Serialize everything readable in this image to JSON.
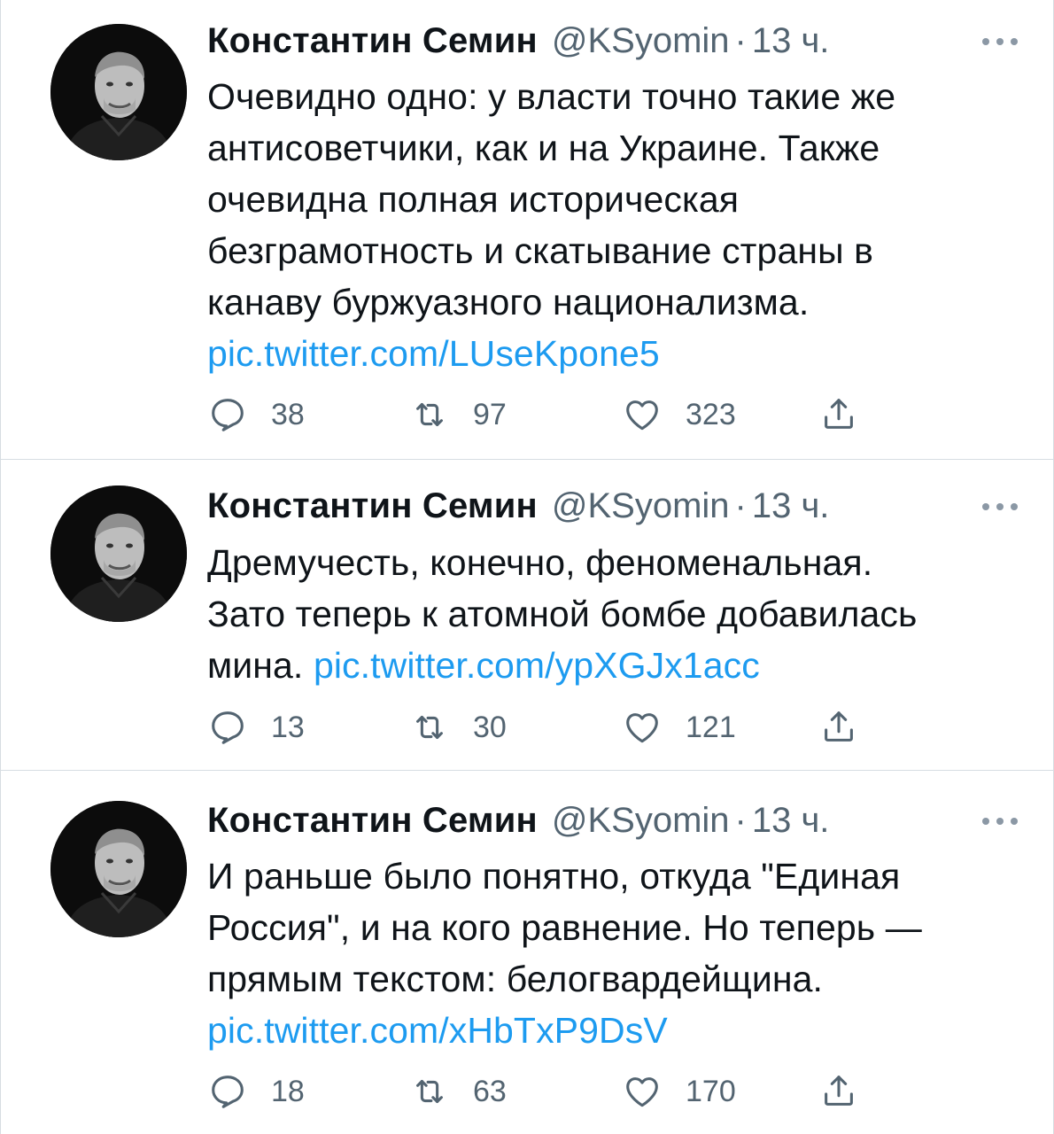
{
  "tweets": [
    {
      "author_name": "Константин Семин",
      "handle": "@KSyomin",
      "separator": "·",
      "time": "13 ч.",
      "text_lines": [
        "Очевидно одно: у власти точно такие же",
        "антисоветчики, как и на Украине. Также",
        "очевидна полная историческая",
        "безграмотность и скатывание страны в",
        "канаву буржуазного национализма."
      ],
      "link": "pic.twitter.com/LUseKpone5",
      "replies": "38",
      "retweets": "97",
      "likes": "323"
    },
    {
      "author_name": "Константин Семин",
      "handle": "@KSyomin",
      "separator": "·",
      "time": "13 ч.",
      "text_lines": [
        "Дремучесть, конечно, феноменальная.",
        "Зато теперь к атомной бомбе добавилась",
        "мина."
      ],
      "link": "pic.twitter.com/ypXGJx1acc",
      "replies": "13",
      "retweets": "30",
      "likes": "121"
    },
    {
      "author_name": "Константин Семин",
      "handle": "@KSyomin",
      "separator": "·",
      "time": "13 ч.",
      "text_lines": [
        "И раньше было понятно, откуда \"Единая",
        "Россия\", и на кого равнение. Но теперь —",
        "прямым текстом: белогвардейщина."
      ],
      "link": "pic.twitter.com/xHbTxP9DsV",
      "replies": "18",
      "retweets": "63",
      "likes": "170"
    }
  ],
  "colors": {
    "link": "#1d9bf0",
    "secondary_text": "#536471",
    "divider": "#d7dde2"
  },
  "icons": [
    "reply-icon",
    "retweet-icon",
    "like-icon",
    "share-icon",
    "more-icon"
  ]
}
